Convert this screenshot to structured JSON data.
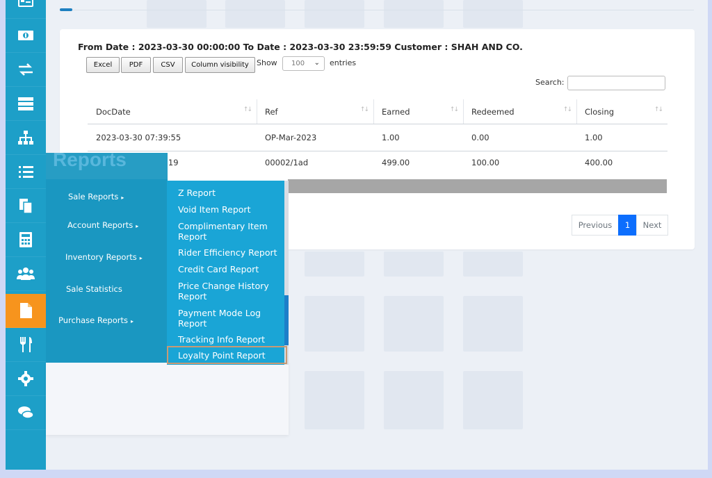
{
  "sidebar": {
    "icons": [
      "newspaper-icon",
      "money-icon",
      "exchange-icon",
      "server-icon",
      "sitemap-icon",
      "list-ol-icon",
      "copy-icon",
      "calculator-icon",
      "users-icon",
      "file-icon",
      "utensils-icon",
      "cog-icon",
      "comments-icon"
    ],
    "active_index": 9
  },
  "report": {
    "title": "From Date : 2023-03-30 00:00:00 To Date : 2023-03-30 23:59:59 Customer : SHAH AND CO.",
    "buttons": {
      "excel": "Excel",
      "pdf": "PDF",
      "csv": "CSV",
      "column_visibility": "Column visibility"
    },
    "show_label": "Show",
    "entries_value": "100",
    "entries_label": "entries",
    "search_label": "Search:",
    "columns": [
      "DocDate",
      "Ref",
      "Earned",
      "Redeemed",
      "Closing"
    ],
    "rows": [
      [
        "2023-03-30 07:39:55",
        "OP-Mar-2023",
        "1.00",
        "0.00",
        "1.00"
      ],
      [
        ":19",
        "00002/1ad",
        "499.00",
        "100.00",
        "400.00"
      ]
    ],
    "pagination": {
      "previous": "Previous",
      "current": "1",
      "next": "Next"
    }
  },
  "menu": {
    "heading": "Reports",
    "items": [
      "Sale Reports",
      "Account Reports",
      "Inventory Reports",
      "Sale Statistics",
      "Purchase Reports"
    ],
    "arrow": "▸"
  },
  "submenu": {
    "items": [
      "Z Report",
      "Void Item Report",
      "Complimentary Item Report",
      "Rider Efficiency Report",
      "Credit Card Report",
      "Price Change History Report",
      "Payment Mode Log Report",
      "Tracking Info Report",
      "Loyalty Point Report"
    ],
    "highlighted": "Loyalty Point Report"
  }
}
